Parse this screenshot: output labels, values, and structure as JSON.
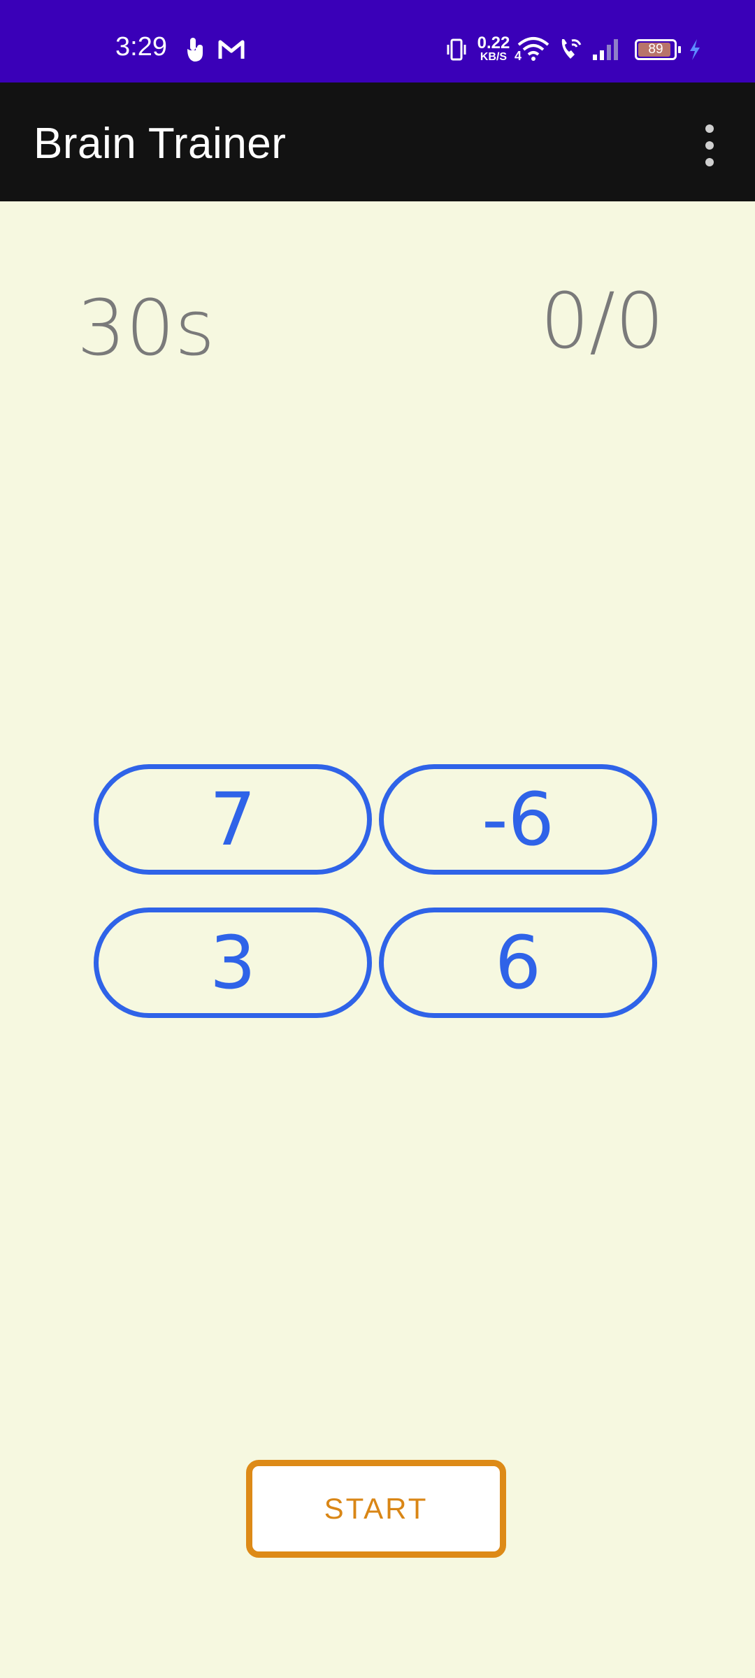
{
  "status_bar": {
    "time": "3:29",
    "net_speed_value": "0.22",
    "net_speed_unit": "KB/S",
    "network_type": "4",
    "battery": "89",
    "colors": {
      "background": "#3a00b8",
      "icon": "#ffffff"
    },
    "icons": [
      "touch-gesture-icon",
      "gmail-icon",
      "vibrate-icon",
      "wifi-icon",
      "wifi-calling-icon",
      "signal-icon",
      "battery-icon",
      "charging-icon"
    ]
  },
  "app_bar": {
    "title": "Brain Trainer",
    "menu_icon": "more-vert-icon",
    "background": "#121212"
  },
  "game": {
    "timer": "30s",
    "score": "0/0",
    "answers": [
      "7",
      "-6",
      "3",
      "6"
    ],
    "answer_color": "#2f63e8"
  },
  "start_button": {
    "label": "START",
    "color": "#dd8a17"
  },
  "background_color": "#f6f8e0"
}
